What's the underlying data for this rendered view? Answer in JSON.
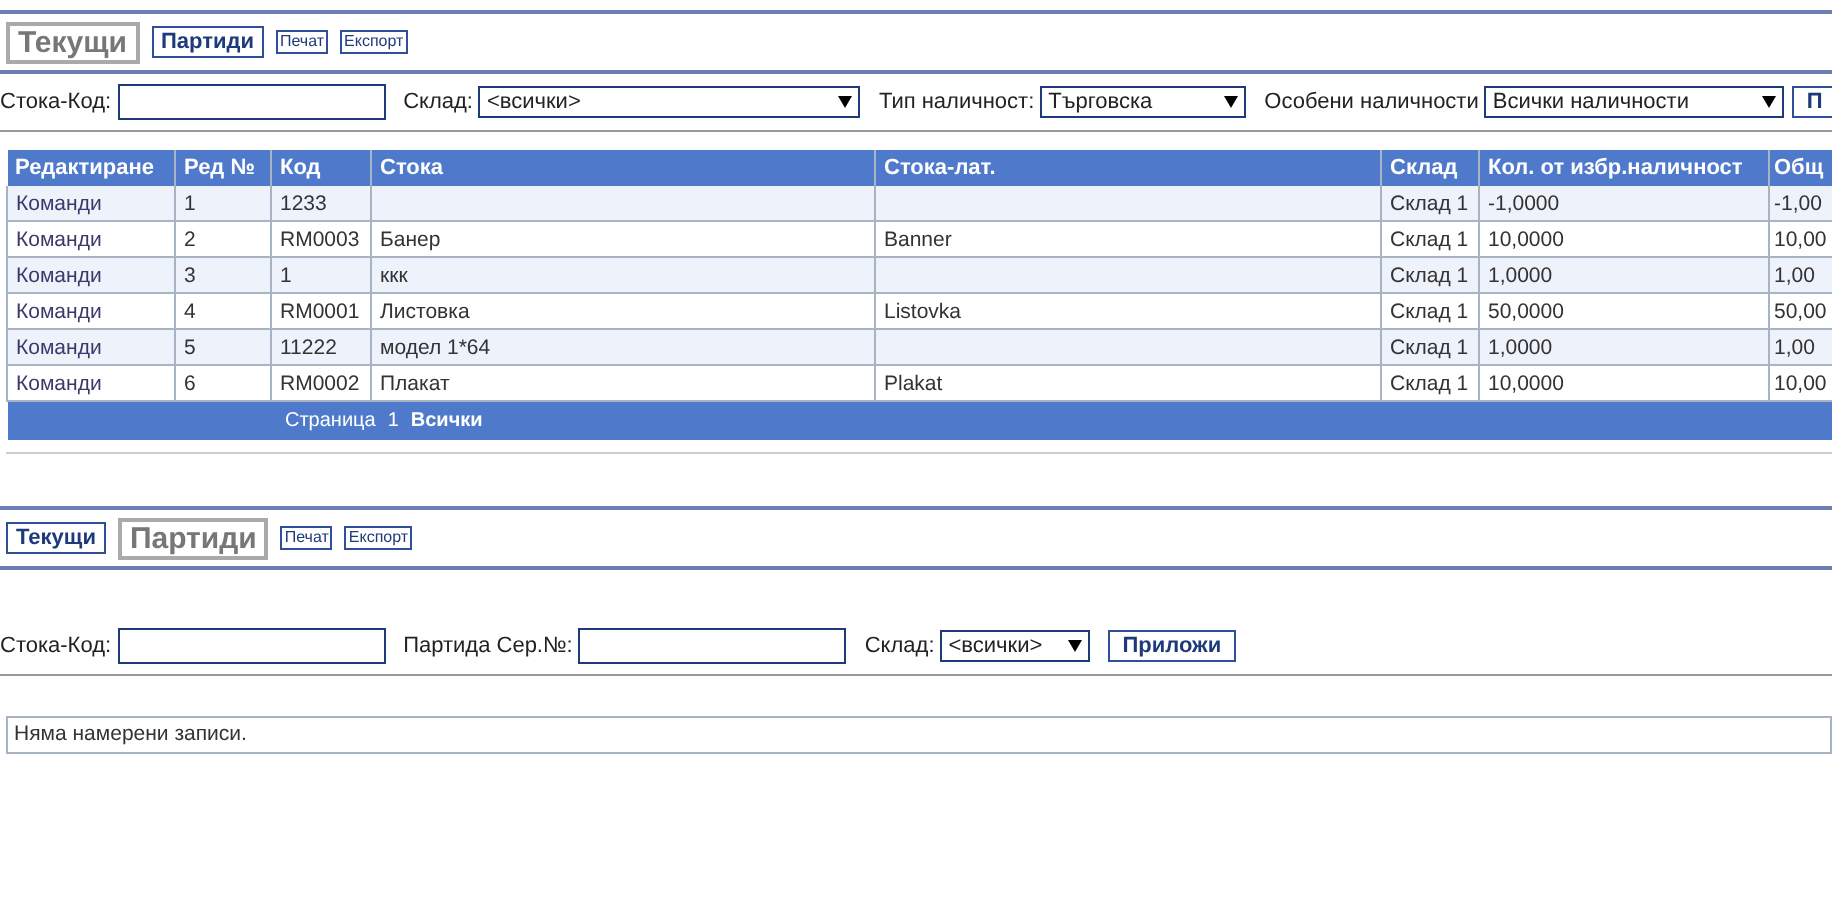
{
  "current_panel": {
    "tabs": [
      {
        "label": "Текущи",
        "selected": true
      },
      {
        "label": "Партиди",
        "selected": false
      }
    ],
    "actions": [
      "Печат",
      "Експорт"
    ],
    "filters": [
      {
        "kind": "text",
        "label": "Стока-Код:"
      },
      {
        "kind": "select",
        "label": "Склад:",
        "value": "<всички>"
      },
      {
        "kind": "select",
        "label": "Тип наличност:",
        "value": "Търговска"
      },
      {
        "kind": "select",
        "label": "Особени наличности",
        "value": "Всички наличности"
      },
      {
        "kind": "button",
        "label": "П"
      }
    ],
    "table": {
      "columns": [
        "Редактиране",
        "Ред №",
        "Код",
        "Стока",
        "Стока-лат.",
        "Склад",
        "Кол. от избр.наличност",
        "Общ"
      ],
      "rows": [
        [
          "Команди",
          "1",
          "1233",
          "",
          "",
          "Склад 1",
          "-1,0000",
          "-1,00"
        ],
        [
          "Команди",
          "2",
          "RM0003",
          "Банер",
          "Banner",
          "Склад 1",
          "10,0000",
          "10,00"
        ],
        [
          "Команди",
          "3",
          "1",
          "ккк",
          "",
          "Склад 1",
          "1,0000",
          "1,00"
        ],
        [
          "Команди",
          "4",
          "RM0001",
          "Листовка",
          "Listovka",
          "Склад 1",
          "50,0000",
          "50,00"
        ],
        [
          "Команди",
          "5",
          "11222",
          "модел 1*64",
          "",
          "Склад 1",
          "1,0000",
          "1,00"
        ],
        [
          "Команди",
          "6",
          "RM0002",
          "Плакат",
          "Plakat",
          "Склад 1",
          "10,0000",
          "10,00"
        ]
      ],
      "pager": {
        "label": "Страница",
        "pages": [
          {
            "label": "1",
            "selected": false
          },
          {
            "label": "Всички",
            "selected": true
          }
        ]
      }
    }
  },
  "batches_panel": {
    "tabs": [
      {
        "label": "Текущи",
        "selected": false
      },
      {
        "label": "Партиди",
        "selected": true
      }
    ],
    "actions": [
      "Печат",
      "Експорт"
    ],
    "filters": [
      {
        "kind": "text",
        "label": "Стока-Код:"
      },
      {
        "kind": "text",
        "label": "Партида Сер.№:"
      },
      {
        "kind": "select",
        "label": "Склад:",
        "value": "<всички>"
      },
      {
        "kind": "button",
        "label": "Приложи"
      }
    ],
    "message": "Няма намерени записи."
  }
}
